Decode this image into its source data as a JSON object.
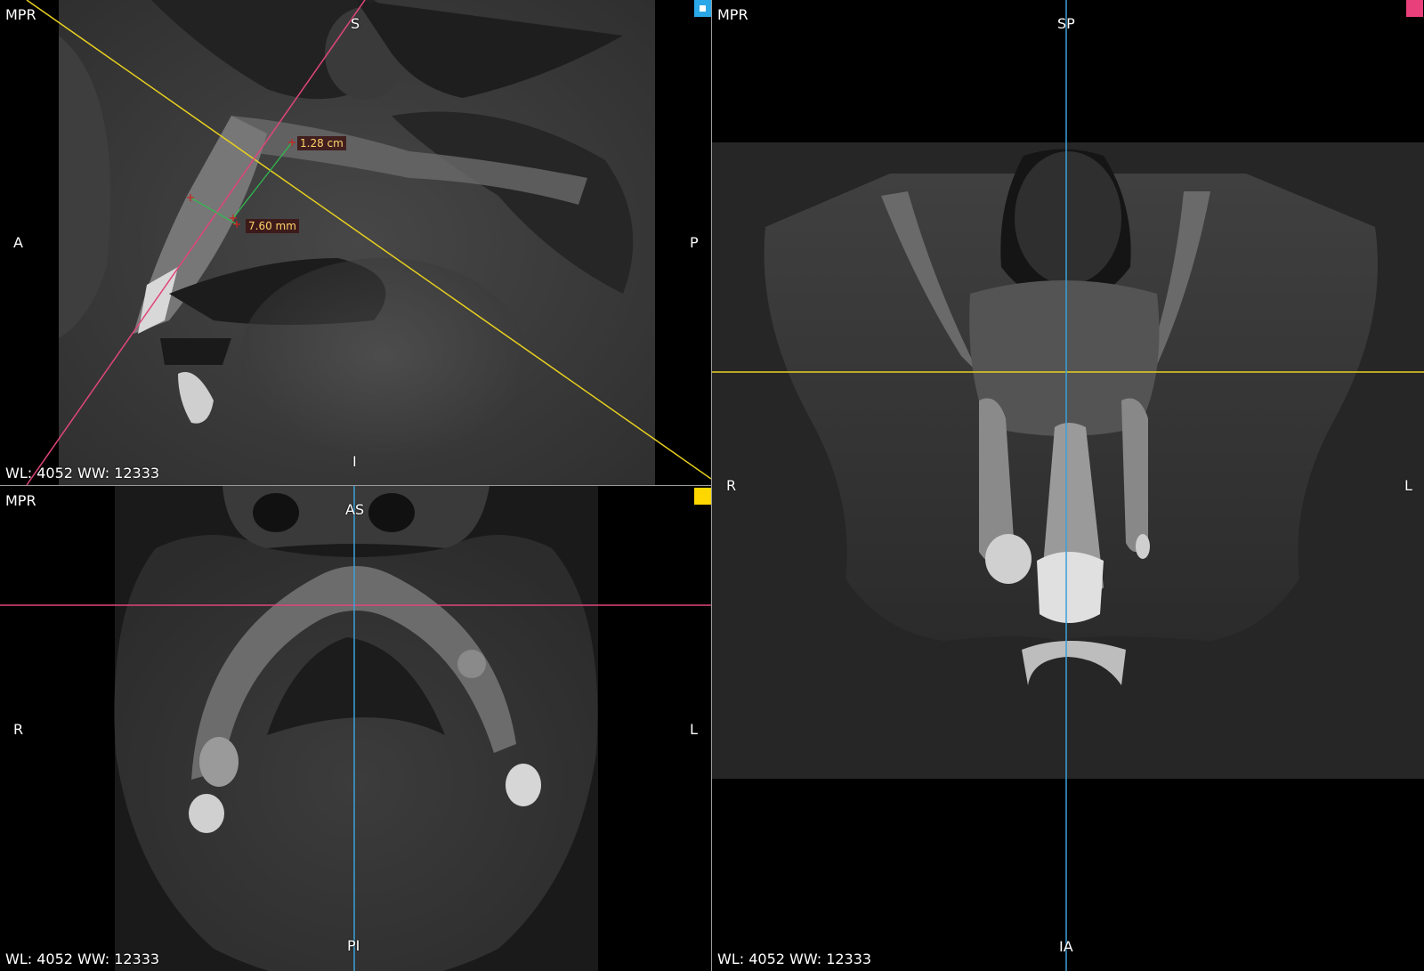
{
  "viewports": {
    "sagittal": {
      "title": "MPR",
      "orientation": {
        "top": "S",
        "bottom": "I",
        "left": "A",
        "right": "P"
      },
      "window": "WL: 4052 WW: 12333",
      "marker_color": "#2aa8e8",
      "measurements": [
        {
          "label": "1.28 cm"
        },
        {
          "label": "7.60 mm"
        }
      ]
    },
    "axial": {
      "title": "MPR",
      "orientation": {
        "top": "AS",
        "bottom": "PI",
        "left": "R",
        "right": "L"
      },
      "window": "WL: 4052 WW: 12333",
      "marker_color": "#ffd700"
    },
    "coronal": {
      "title": "MPR",
      "orientation": {
        "top": "SP",
        "bottom": "IA",
        "left": "R",
        "right": "L"
      },
      "window": "WL: 4052 WW: 12333",
      "marker_color": "#e8407a"
    }
  },
  "colors": {
    "reference_cyan": "#3aa0d8",
    "reference_yellow": "#e8d020",
    "reference_pink": "#e0457c",
    "measurement_line": "#2fbf4f",
    "measurement_handle": "#d02020",
    "divider": "#9a9a9a"
  }
}
